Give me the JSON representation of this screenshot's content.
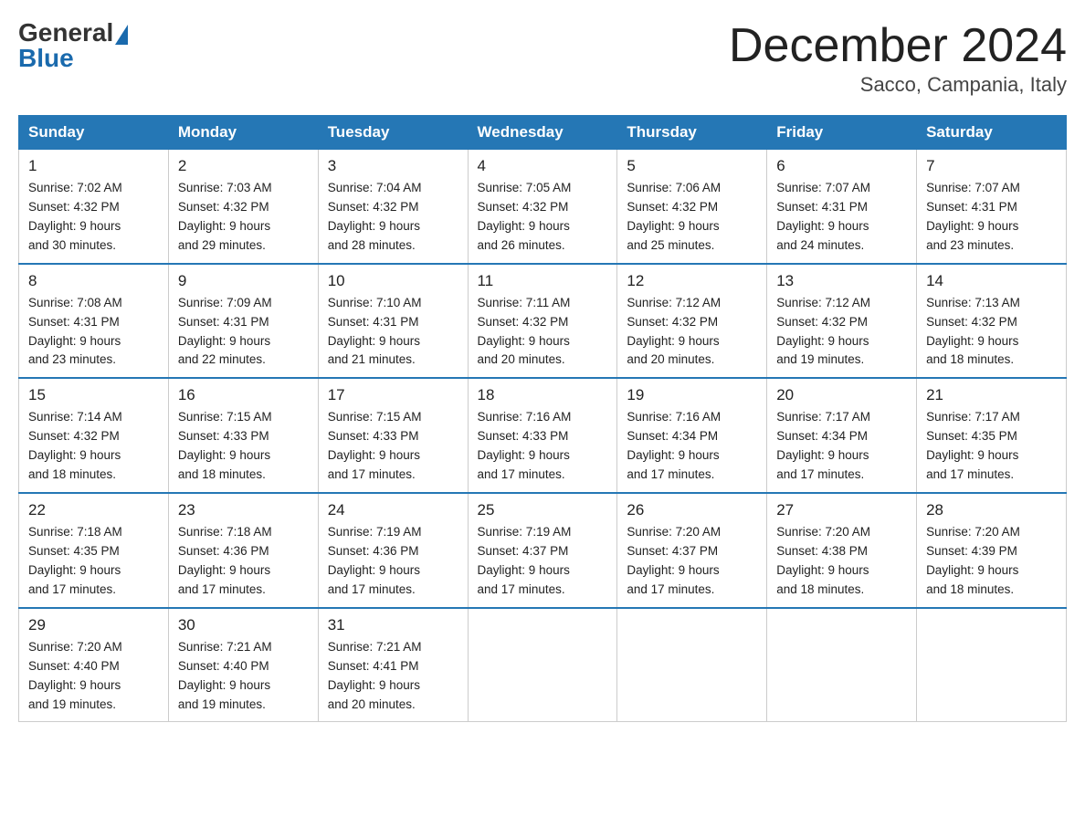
{
  "logo": {
    "general": "General",
    "blue": "Blue"
  },
  "title": "December 2024",
  "location": "Sacco, Campania, Italy",
  "days_of_week": [
    "Sunday",
    "Monday",
    "Tuesday",
    "Wednesday",
    "Thursday",
    "Friday",
    "Saturday"
  ],
  "weeks": [
    [
      {
        "num": "1",
        "sunrise": "7:02 AM",
        "sunset": "4:32 PM",
        "daylight": "9 hours and 30 minutes."
      },
      {
        "num": "2",
        "sunrise": "7:03 AM",
        "sunset": "4:32 PM",
        "daylight": "9 hours and 29 minutes."
      },
      {
        "num": "3",
        "sunrise": "7:04 AM",
        "sunset": "4:32 PM",
        "daylight": "9 hours and 28 minutes."
      },
      {
        "num": "4",
        "sunrise": "7:05 AM",
        "sunset": "4:32 PM",
        "daylight": "9 hours and 26 minutes."
      },
      {
        "num": "5",
        "sunrise": "7:06 AM",
        "sunset": "4:32 PM",
        "daylight": "9 hours and 25 minutes."
      },
      {
        "num": "6",
        "sunrise": "7:07 AM",
        "sunset": "4:31 PM",
        "daylight": "9 hours and 24 minutes."
      },
      {
        "num": "7",
        "sunrise": "7:07 AM",
        "sunset": "4:31 PM",
        "daylight": "9 hours and 23 minutes."
      }
    ],
    [
      {
        "num": "8",
        "sunrise": "7:08 AM",
        "sunset": "4:31 PM",
        "daylight": "9 hours and 23 minutes."
      },
      {
        "num": "9",
        "sunrise": "7:09 AM",
        "sunset": "4:31 PM",
        "daylight": "9 hours and 22 minutes."
      },
      {
        "num": "10",
        "sunrise": "7:10 AM",
        "sunset": "4:31 PM",
        "daylight": "9 hours and 21 minutes."
      },
      {
        "num": "11",
        "sunrise": "7:11 AM",
        "sunset": "4:32 PM",
        "daylight": "9 hours and 20 minutes."
      },
      {
        "num": "12",
        "sunrise": "7:12 AM",
        "sunset": "4:32 PM",
        "daylight": "9 hours and 20 minutes."
      },
      {
        "num": "13",
        "sunrise": "7:12 AM",
        "sunset": "4:32 PM",
        "daylight": "9 hours and 19 minutes."
      },
      {
        "num": "14",
        "sunrise": "7:13 AM",
        "sunset": "4:32 PM",
        "daylight": "9 hours and 18 minutes."
      }
    ],
    [
      {
        "num": "15",
        "sunrise": "7:14 AM",
        "sunset": "4:32 PM",
        "daylight": "9 hours and 18 minutes."
      },
      {
        "num": "16",
        "sunrise": "7:15 AM",
        "sunset": "4:33 PM",
        "daylight": "9 hours and 18 minutes."
      },
      {
        "num": "17",
        "sunrise": "7:15 AM",
        "sunset": "4:33 PM",
        "daylight": "9 hours and 17 minutes."
      },
      {
        "num": "18",
        "sunrise": "7:16 AM",
        "sunset": "4:33 PM",
        "daylight": "9 hours and 17 minutes."
      },
      {
        "num": "19",
        "sunrise": "7:16 AM",
        "sunset": "4:34 PM",
        "daylight": "9 hours and 17 minutes."
      },
      {
        "num": "20",
        "sunrise": "7:17 AM",
        "sunset": "4:34 PM",
        "daylight": "9 hours and 17 minutes."
      },
      {
        "num": "21",
        "sunrise": "7:17 AM",
        "sunset": "4:35 PM",
        "daylight": "9 hours and 17 minutes."
      }
    ],
    [
      {
        "num": "22",
        "sunrise": "7:18 AM",
        "sunset": "4:35 PM",
        "daylight": "9 hours and 17 minutes."
      },
      {
        "num": "23",
        "sunrise": "7:18 AM",
        "sunset": "4:36 PM",
        "daylight": "9 hours and 17 minutes."
      },
      {
        "num": "24",
        "sunrise": "7:19 AM",
        "sunset": "4:36 PM",
        "daylight": "9 hours and 17 minutes."
      },
      {
        "num": "25",
        "sunrise": "7:19 AM",
        "sunset": "4:37 PM",
        "daylight": "9 hours and 17 minutes."
      },
      {
        "num": "26",
        "sunrise": "7:20 AM",
        "sunset": "4:37 PM",
        "daylight": "9 hours and 17 minutes."
      },
      {
        "num": "27",
        "sunrise": "7:20 AM",
        "sunset": "4:38 PM",
        "daylight": "9 hours and 18 minutes."
      },
      {
        "num": "28",
        "sunrise": "7:20 AM",
        "sunset": "4:39 PM",
        "daylight": "9 hours and 18 minutes."
      }
    ],
    [
      {
        "num": "29",
        "sunrise": "7:20 AM",
        "sunset": "4:40 PM",
        "daylight": "9 hours and 19 minutes."
      },
      {
        "num": "30",
        "sunrise": "7:21 AM",
        "sunset": "4:40 PM",
        "daylight": "9 hours and 19 minutes."
      },
      {
        "num": "31",
        "sunrise": "7:21 AM",
        "sunset": "4:41 PM",
        "daylight": "9 hours and 20 minutes."
      },
      null,
      null,
      null,
      null
    ]
  ]
}
